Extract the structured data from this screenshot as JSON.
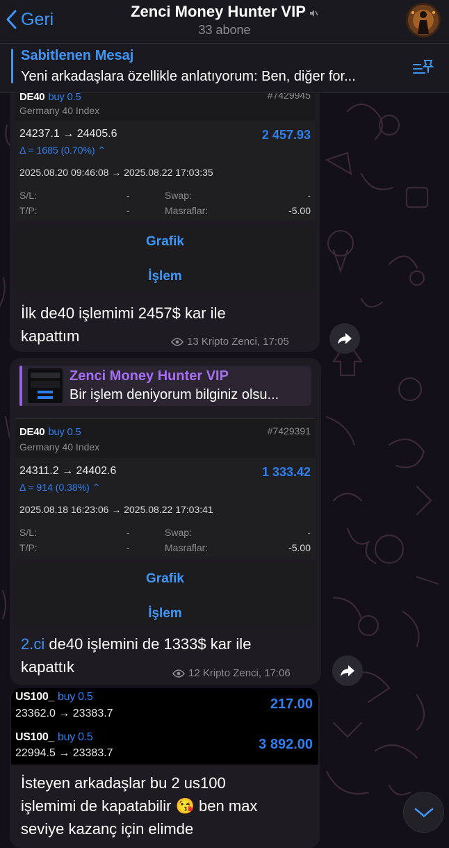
{
  "header": {
    "back_label": "Geri",
    "channel_title": "Zenci Money Hunter VIP",
    "subscribers": "33 abone"
  },
  "pinned": {
    "title": "Sabitlenen Mesaj",
    "text": "Yeni arkadaşlara özellikle anlatıyorum: Ben, diğer for..."
  },
  "messages": [
    {
      "trade": {
        "symbol": "DE40",
        "side": "buy 0.5",
        "ticket": "#7429945",
        "description": "Germany 40 Index",
        "prices": "24237.1 → 24405.6",
        "profit": "2 457.93",
        "delta": "Δ = 1685 (0.70%)",
        "times": "2025.08.20 09:46:08 → 2025.08.22 17:03:35",
        "sl_label": "S/L:",
        "sl_value": "-",
        "tp_label": "T/P:",
        "tp_value": "-",
        "swap_label": "Swap:",
        "swap_value": "-",
        "fees_label": "Masraflar:",
        "fees_value": "-5.00",
        "button_chart": "Grafik",
        "button_trade": "İşlem"
      },
      "text_line1": "İlk de40 işlemimi 2457$ kar ile",
      "text_line2": "kapattım",
      "meta": "13 Kripto Zenci, 17:05"
    },
    {
      "forward": {
        "title": "Zenci Money Hunter VIP",
        "text": "Bir işlem deniyorum bilginiz olsu..."
      },
      "trade": {
        "symbol": "DE40",
        "side": "buy 0.5",
        "ticket": "#7429391",
        "description": "Germany 40 Index",
        "prices": "24311.2 → 24402.6",
        "profit": "1 333.42",
        "delta": "Δ = 914 (0.38%)",
        "times": "2025.08.18 16:23:06 → 2025.08.22 17:03:41",
        "sl_label": "S/L:",
        "sl_value": "-",
        "tp_label": "T/P:",
        "tp_value": "-",
        "swap_label": "Swap:",
        "swap_value": "-",
        "fees_label": "Masraflar:",
        "fees_value": "-5.00",
        "button_chart": "Grafik",
        "button_trade": "İşlem"
      },
      "text_highlight": "2.ci",
      "text_line1": " de40 işlemini de 1333$ kar ile",
      "text_line2": "kapattık",
      "meta": "12 Kripto Zenci, 17:06"
    },
    {
      "positions": [
        {
          "symbol": "US100_",
          "side": "buy 0.5",
          "prices": "23362.0 → 23383.7",
          "profit": "217.00"
        },
        {
          "symbol": "US100_",
          "side": "buy 0.5",
          "prices": "22994.5 → 23383.7",
          "profit": "3 892.00"
        }
      ],
      "text_line1": "İsteyen arkadaşlar bu 2 us100",
      "text_line2_a": "işlemimi de kapatabilir ",
      "emoji": "😘",
      "text_line2_b": " ben max",
      "text_line3": "seviye kazanç için elimde"
    }
  ],
  "colors": {
    "accent": "#3e96f7",
    "forward_accent": "#a66ef5",
    "background": "#141019",
    "bubble": "#1e1c22"
  },
  "icons": [
    "back-chevron-icon",
    "mute-icon",
    "pin-list-icon",
    "eye-icon",
    "share-icon",
    "chevron-down-icon"
  ]
}
